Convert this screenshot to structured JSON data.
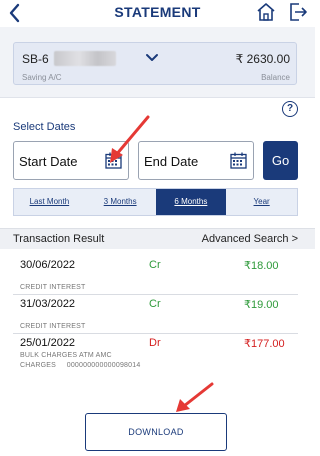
{
  "header": {
    "title": "STATEMENT",
    "back_icon": "chevron-left-icon",
    "home_icon": "home-icon",
    "logout_icon": "logout-icon"
  },
  "account": {
    "number_prefix": "SB-6",
    "balance": "₹ 2630.00",
    "type": "Saving A/C",
    "balance_label": "Balance"
  },
  "dates": {
    "section_label": "Select Dates",
    "start_label": "Start Date",
    "end_label": "End Date",
    "go_label": "Go"
  },
  "periods": [
    {
      "label": "Last Month",
      "active": false
    },
    {
      "label": "3 Months",
      "active": false
    },
    {
      "label": "6 Months",
      "active": true
    },
    {
      "label": "Year",
      "active": false
    }
  ],
  "results": {
    "title": "Transaction Result",
    "advanced_search": "Advanced Search >"
  },
  "transactions": [
    {
      "date": "30/06/2022",
      "type": "Cr",
      "amount": "₹18.00",
      "desc1": "CREDIT INTEREST",
      "desc2": ""
    },
    {
      "date": "31/03/2022",
      "type": "Cr",
      "amount": "₹19.00",
      "desc1": "CREDIT INTEREST",
      "desc2": ""
    },
    {
      "date": "25/01/2022",
      "type": "Dr",
      "amount": "₹177.00",
      "desc1": "BULK CHARGES ATM AMC",
      "desc2": "CHARGES     000000000000098014"
    }
  ],
  "download_label": "DOWNLOAD",
  "colors": {
    "primary": "#1a3a7a",
    "credit": "#2e9a3a",
    "debit": "#d41e1e",
    "annotation_arrow": "#e53935"
  }
}
